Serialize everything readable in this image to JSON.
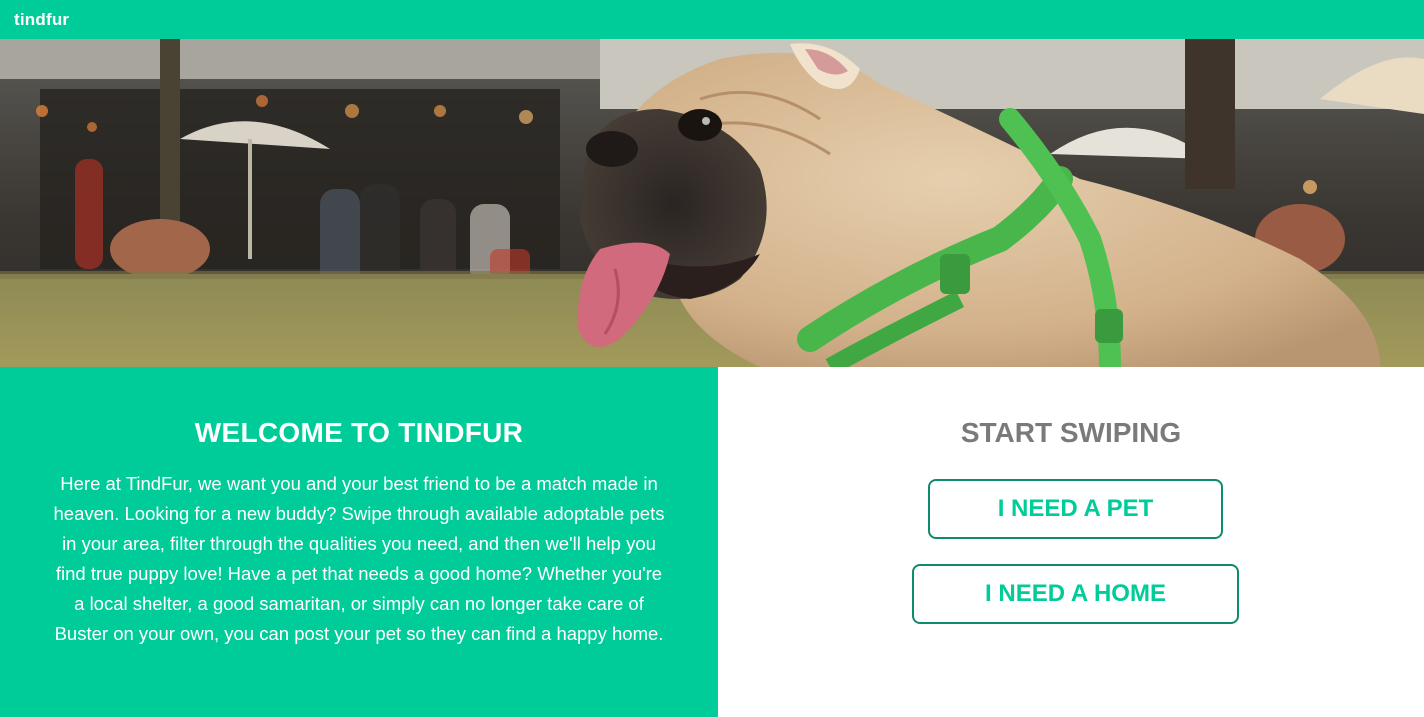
{
  "navbar": {
    "brand": "tindfur"
  },
  "hero": {
    "image": "pug-with-green-harness-photo"
  },
  "welcome": {
    "title": "WELCOME TO TINDFUR",
    "text": "Here at TindFur, we want you and your best friend to be a match made in heaven. Looking for a new buddy? Swipe through available adoptable pets in your area, filter through the qualities you need, and then we'll help you find true puppy love! Have a pet that needs a good home? Whether you're a local shelter, a good samaritan, or simply can no longer take care of Buster on your own, you can post your pet so they can find a happy home."
  },
  "start": {
    "title": "START SWIPING",
    "need_pet_label": "I NEED A PET",
    "need_home_label": "I NEED A HOME"
  },
  "colors": {
    "brand": "#00cc99",
    "button_border": "#0e8a6c",
    "heading_gray": "#7a7a7a"
  }
}
